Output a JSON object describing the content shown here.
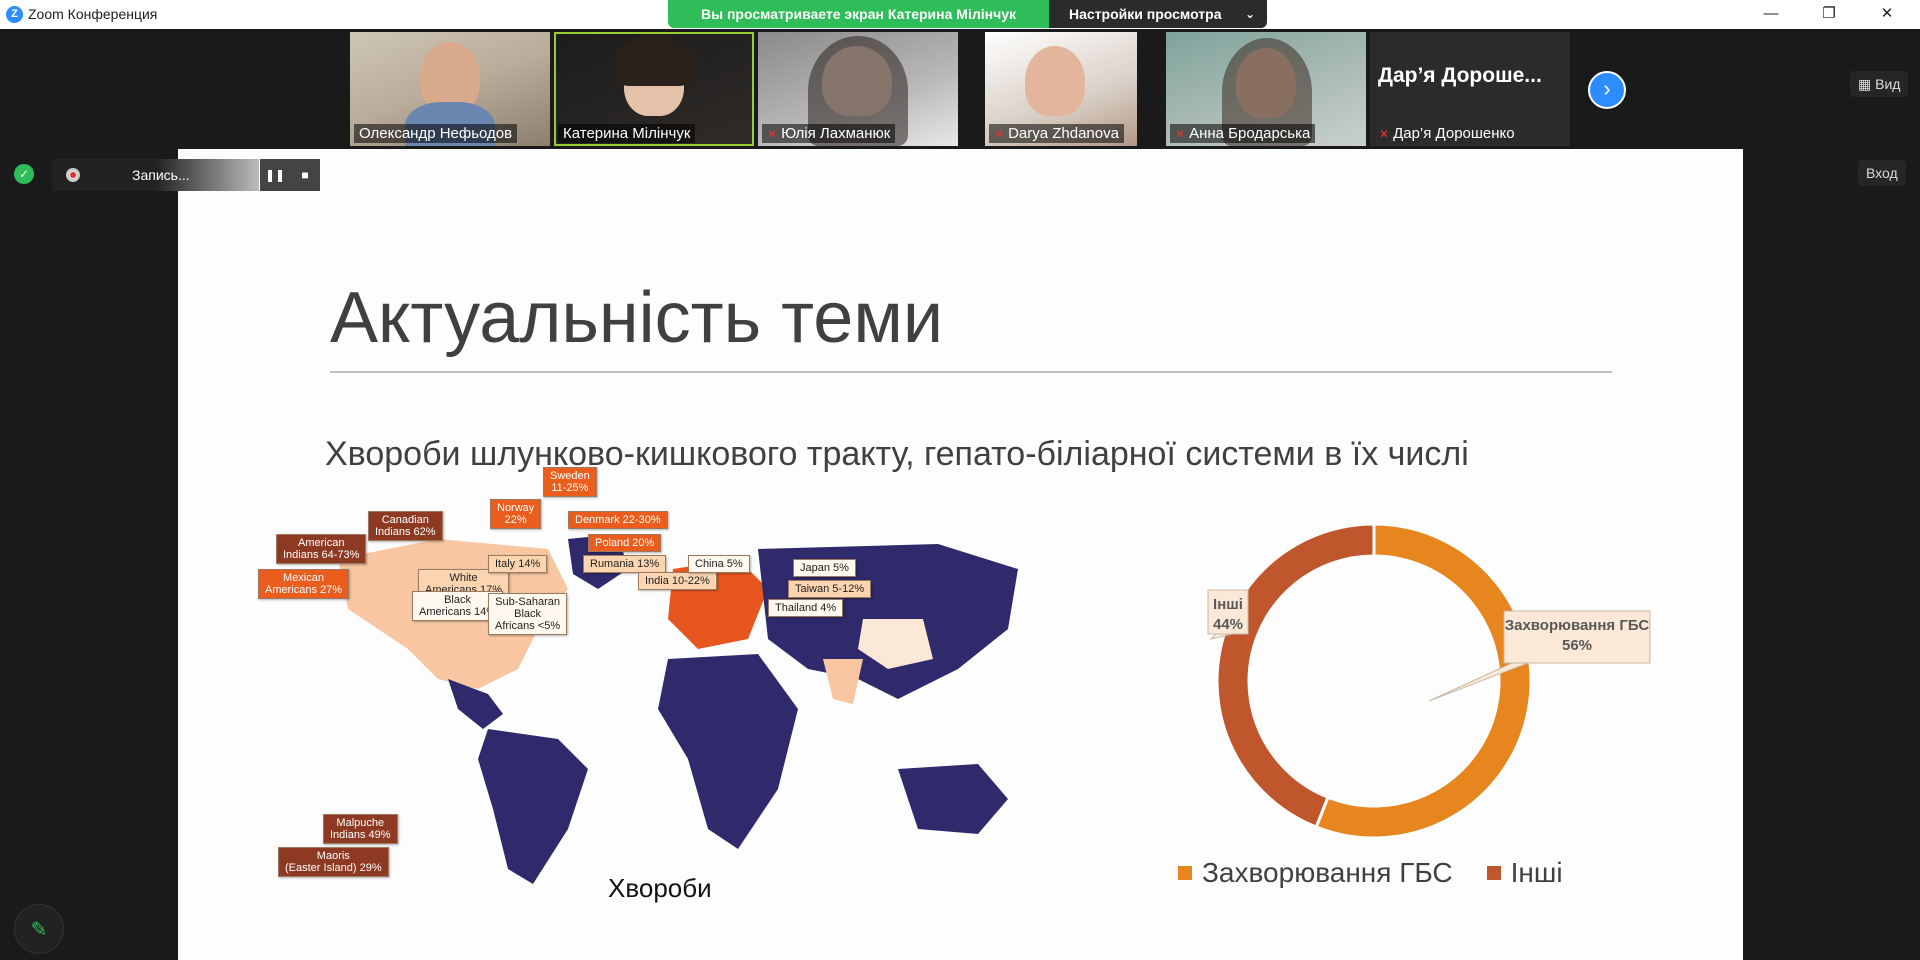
{
  "window": {
    "app_title": "Zoom Конференция",
    "minimize": "—",
    "restore": "❐",
    "close": "✕"
  },
  "share_banner": {
    "text": "Вы просматриваете экран Катерина  Мілінчук",
    "view_settings": "Настройки просмотра",
    "view_settings_chevron": "⌄"
  },
  "participants": [
    {
      "name": "Олександр   Нефьодов",
      "muted": false
    },
    {
      "name": "Катерина  Мілінчук",
      "muted": false,
      "active_speaker": true
    },
    {
      "name": "Юлія Лахманюк",
      "muted": true
    },
    {
      "name": "Darya Zhdanova",
      "muted": true
    },
    {
      "name": "Анна Бродарська",
      "muted": true
    },
    {
      "name": "Дар’я Дорошенко",
      "muted": true,
      "video_off_label": "Дар’я  Дороше..."
    }
  ],
  "gallery": {
    "next_icon": "›",
    "view_label": "Вид",
    "enter_label": "Вход"
  },
  "recording": {
    "label": "Запись...",
    "pause": "❚❚",
    "stop": "■"
  },
  "icons": {
    "shield": "✓",
    "pencil": "✎"
  },
  "slide": {
    "title": "Актуальність теми",
    "subtitle": "Хвороби шлунково-кишкового тракту, гепато-біліарної системи в їх числі",
    "map_caption": "Хвороби",
    "map_labels": [
      {
        "text": "Canadian\nIndians 62%",
        "tone": "dark"
      },
      {
        "text": "American\nIndians 64-73%",
        "tone": "dark"
      },
      {
        "text": "White\nAmericans 17%",
        "tone": "pale"
      },
      {
        "text": "Mexican\nAmericans 27%",
        "tone": "orange"
      },
      {
        "text": "Black\nAmericans 14%",
        "tone": "light"
      },
      {
        "text": "Malpuche\nIndians 49%",
        "tone": "dark"
      },
      {
        "text": "Maoris\n(Easter Island) 29%",
        "tone": "dark"
      },
      {
        "text": "Sweden\n11-25%",
        "tone": "orange"
      },
      {
        "text": "Norway\n22%",
        "tone": "orange"
      },
      {
        "text": "Denmark 22-30%",
        "tone": "orange"
      },
      {
        "text": "Poland 20%",
        "tone": "orange"
      },
      {
        "text": "Italy 14%",
        "tone": "pale"
      },
      {
        "text": "Rumania 13%",
        "tone": "pale"
      },
      {
        "text": "India 10-22%",
        "tone": "pale"
      },
      {
        "text": "China 5%",
        "tone": "light"
      },
      {
        "text": "Sub-Saharan\nBlack\nAfricans <5%",
        "tone": "light"
      },
      {
        "text": "Japan 5%",
        "tone": "light"
      },
      {
        "text": "Taiwan 5-12%",
        "tone": "pale"
      },
      {
        "text": "Thailand 4%",
        "tone": "light"
      }
    ]
  },
  "chart_data": {
    "type": "pie",
    "donut": true,
    "categories": [
      "Захворювання ГБС",
      "Інші"
    ],
    "values": [
      56,
      44
    ],
    "data_labels": [
      "Захворювання ГБС\n56%",
      "Інші\n44%"
    ],
    "colors": [
      "#e7851e",
      "#c0562c"
    ],
    "legend_position": "bottom"
  }
}
